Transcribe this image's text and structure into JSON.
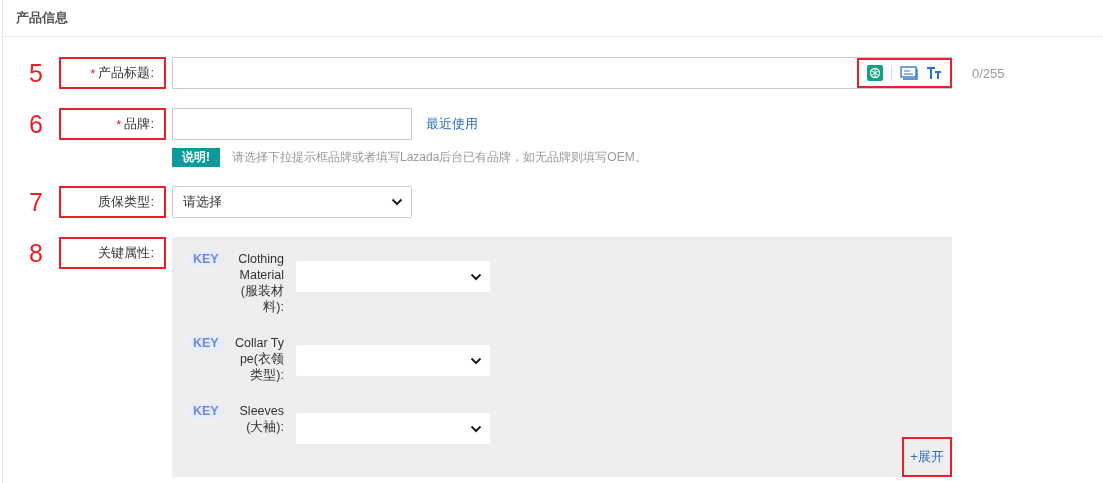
{
  "section": {
    "title": "产品信息"
  },
  "fields": [
    {
      "kind": "title",
      "marker": "5",
      "label": "产品标题:",
      "required_mark": "*",
      "highlighted": true,
      "counter": "0/255",
      "tools_highlighted": true
    },
    {
      "kind": "brand",
      "marker": "6",
      "label": "品牌:",
      "required_mark": "*",
      "highlighted": true,
      "link": "最近使用",
      "note_badge": "说明!",
      "note": "请选择下拉提示框品牌或者填写Lazada后台已有品牌，如无品牌则填写OEM。"
    },
    {
      "kind": "select",
      "marker": "7",
      "label": "质保类型:",
      "highlighted": true,
      "value": "请选择"
    },
    {
      "kind": "attributes",
      "marker": "8",
      "label": "关键属性:",
      "highlighted": true,
      "attributes": [
        {
          "badge": "KEY",
          "label": "Clothing Material(服装材料):"
        },
        {
          "badge": "KEY",
          "label": "Collar Type(衣领类型):"
        },
        {
          "badge": "KEY",
          "label": "Sleeves(大袖):"
        }
      ],
      "expand": "+展开",
      "expand_highlighted": true
    }
  ]
}
